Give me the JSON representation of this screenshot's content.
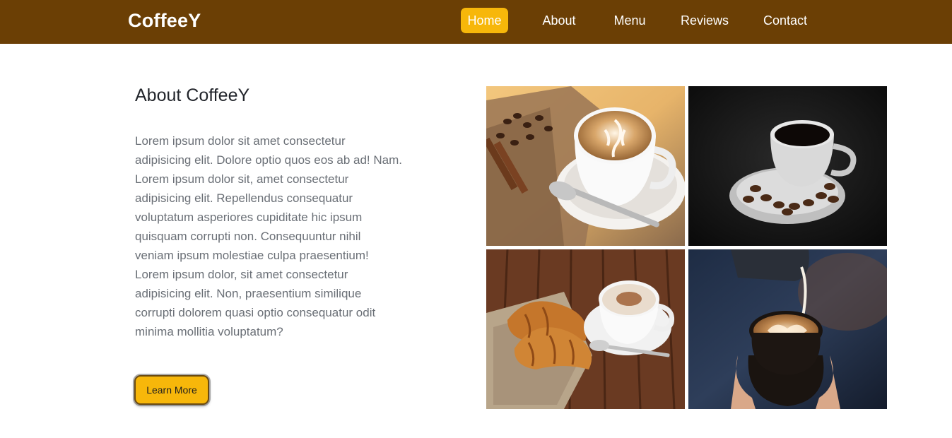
{
  "header": {
    "brand": "CoffeeY",
    "nav": [
      {
        "label": "Home",
        "active": true
      },
      {
        "label": "About",
        "active": false
      },
      {
        "label": "Menu",
        "active": false
      },
      {
        "label": "Reviews",
        "active": false
      },
      {
        "label": "Contact",
        "active": false
      }
    ]
  },
  "about": {
    "title": "About CoffeeY",
    "text": "Lorem ipsum dolor sit amet consectetur adipisicing elit. Dolore optio quos eos ab ad! Nam. Lorem ipsum dolor sit, amet consectetur adipisicing elit. Repellendus consequatur voluptatum asperiores cupiditate hic ipsum quisquam corrupti non. Consequuntur nihil veniam ipsum molestiae culpa praesentium! Lorem ipsum dolor, sit amet consectetur adipisicing elit. Non, praesentium similique corrupti dolorem quasi optio consequatur odit minima mollitia voluptatum?",
    "button_label": "Learn More"
  },
  "gallery": [
    {
      "icon": "latte-art-cup-photo"
    },
    {
      "icon": "black-coffee-beans-photo"
    },
    {
      "icon": "croissant-cappuccino-photo"
    },
    {
      "icon": "milk-pour-latte-photo"
    }
  ],
  "colors": {
    "navbar": "#6b3f05",
    "accent": "#f7b70a",
    "heading": "#22252b",
    "body_text": "#6a6f76"
  }
}
